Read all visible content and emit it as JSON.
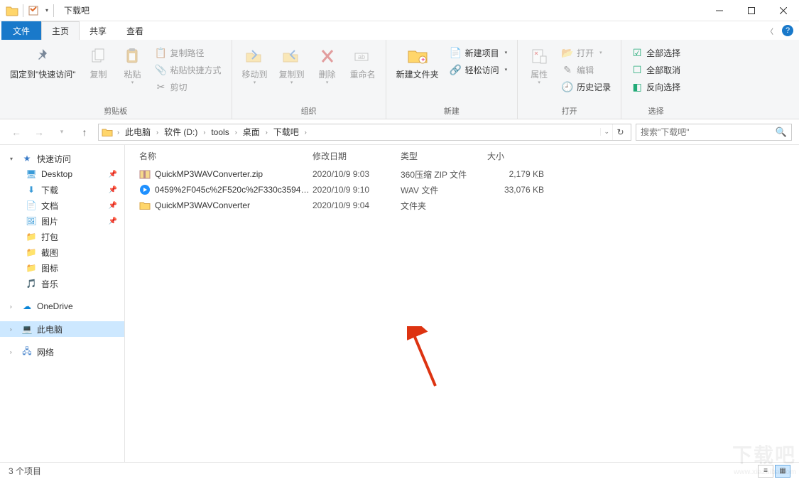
{
  "window": {
    "title": "下载吧"
  },
  "tabs": {
    "file": "文件",
    "home": "主页",
    "share": "共享",
    "view": "查看"
  },
  "ribbon": {
    "clipboard": {
      "label": "剪贴板",
      "pin": "固定到\"快速访问\"",
      "copy": "复制",
      "paste": "粘贴",
      "copy_path": "复制路径",
      "paste_shortcut": "粘贴快捷方式",
      "cut": "剪切"
    },
    "organize": {
      "label": "组织",
      "move_to": "移动到",
      "copy_to": "复制到",
      "delete": "删除",
      "rename": "重命名"
    },
    "new": {
      "label": "新建",
      "new_folder": "新建文件夹",
      "new_item": "新建项目",
      "easy_access": "轻松访问"
    },
    "open": {
      "label": "打开",
      "properties": "属性",
      "open": "打开",
      "edit": "编辑",
      "history": "历史记录"
    },
    "select": {
      "label": "选择",
      "select_all": "全部选择",
      "select_none": "全部取消",
      "invert": "反向选择"
    }
  },
  "breadcrumb": [
    "此电脑",
    "软件 (D:)",
    "tools",
    "桌面",
    "下载吧"
  ],
  "search": {
    "placeholder": "搜索\"下载吧\""
  },
  "tree": {
    "quick_access": "快速访问",
    "items": [
      {
        "label": "Desktop",
        "pinned": true
      },
      {
        "label": "下载",
        "pinned": true
      },
      {
        "label": "文档",
        "pinned": true
      },
      {
        "label": "图片",
        "pinned": true
      },
      {
        "label": "打包",
        "pinned": false
      },
      {
        "label": "截图",
        "pinned": false
      },
      {
        "label": "图标",
        "pinned": false
      },
      {
        "label": "音乐",
        "pinned": false
      }
    ],
    "onedrive": "OneDrive",
    "this_pc": "此电脑",
    "network": "网络"
  },
  "columns": {
    "name": "名称",
    "date": "修改日期",
    "type": "类型",
    "size": "大小"
  },
  "files": [
    {
      "name": "QuickMP3WAVConverter.zip",
      "date": "2020/10/9 9:03",
      "type": "360压缩 ZIP 文件",
      "size": "2,179 KB",
      "icon": "zip"
    },
    {
      "name": "0459%2F045c%2F520c%2F330c35947...",
      "date": "2020/10/9 9:10",
      "type": "WAV 文件",
      "size": "33,076 KB",
      "icon": "wav"
    },
    {
      "name": "QuickMP3WAVConverter",
      "date": "2020/10/9 9:04",
      "type": "文件夹",
      "size": "",
      "icon": "folder"
    }
  ],
  "status": {
    "count": "3 个项目"
  },
  "watermark": {
    "main": "下载吧",
    "sub": "www.xiazaiba.com"
  }
}
